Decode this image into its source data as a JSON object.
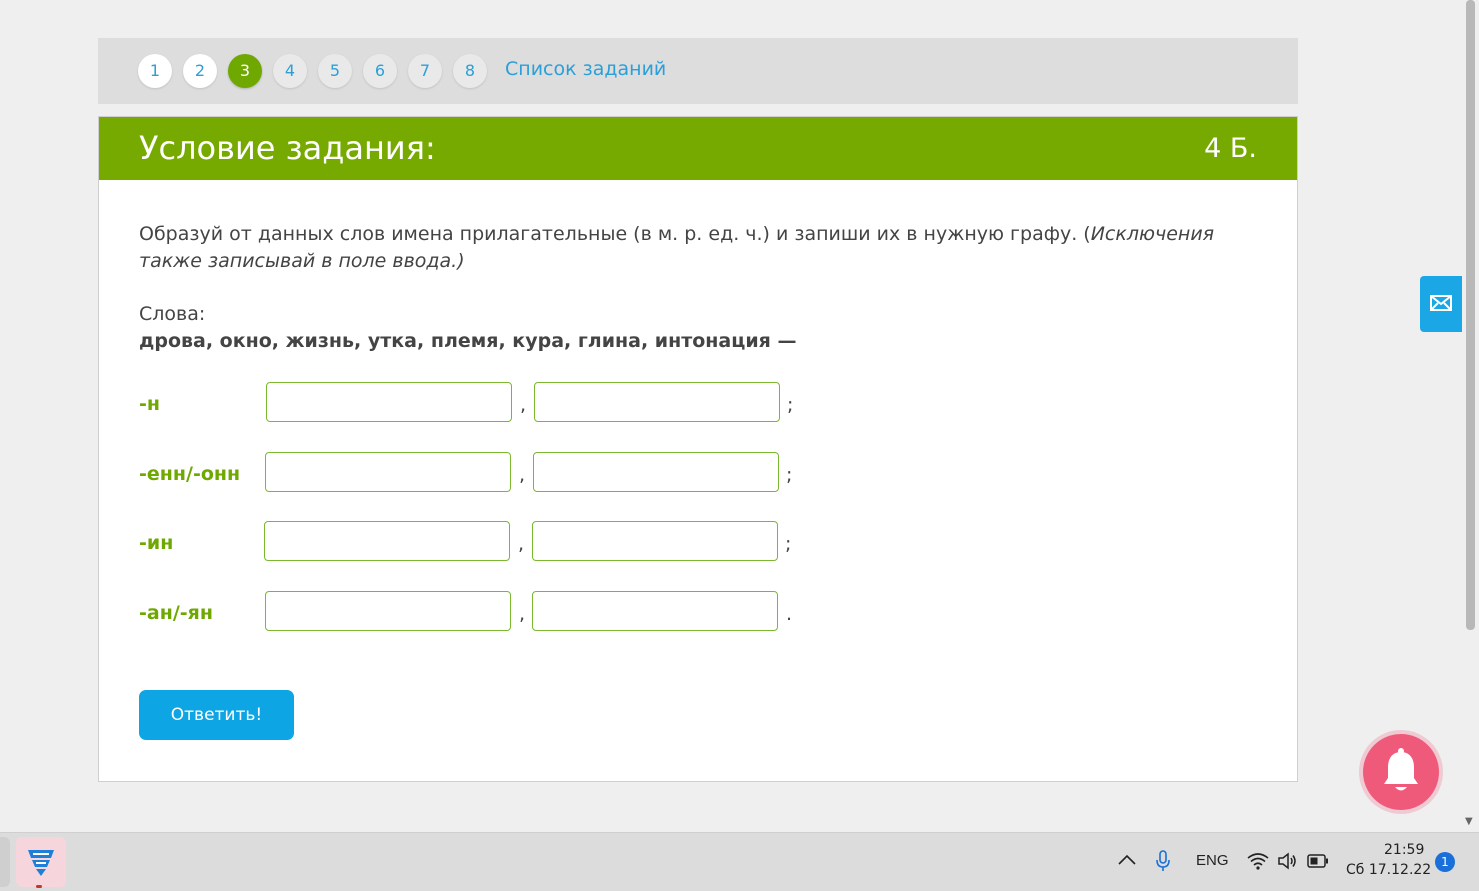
{
  "task_nav": {
    "numbers": [
      "1",
      "2",
      "3",
      "4",
      "5",
      "6",
      "7",
      "8"
    ],
    "active_index": 2,
    "list_link": "Список заданий"
  },
  "task": {
    "title": "Условие задания:",
    "points": "4 Б.",
    "instruction_main": "Образуй от данных слов имена прилагательные (в м. р. ед. ч.) и запиши их в нужную графу. (",
    "instruction_italic": "Исключения также записывай в поле ввода.)",
    "words_label": "Слова:",
    "words": "дрова, окно, жизнь, утка, племя, кура, глина, интонация —"
  },
  "answers": {
    "rows": [
      {
        "suffix": "-н",
        "value_1": "",
        "value_2": "",
        "comma": ",",
        "end": ";"
      },
      {
        "suffix": "-енн/-онн",
        "value_1": "",
        "value_2": "",
        "comma": ",",
        "end": ";"
      },
      {
        "suffix": "-ин",
        "value_1": "",
        "value_2": "",
        "comma": ",",
        "end": ";"
      },
      {
        "suffix": "-ан/-ян",
        "value_1": "",
        "value_2": "",
        "comma": ",",
        "end": "."
      }
    ]
  },
  "submit_label": "Ответить!",
  "taskbar": {
    "language": "ENG",
    "time": "21:59",
    "date": "Сб 17.12.22",
    "notification_count": "1"
  },
  "colors": {
    "accent_green": "#76aa00",
    "link_blue": "#2a9fd8",
    "button_blue": "#0ea5e4",
    "bell_pink": "#ef5a7a"
  },
  "icons": [
    "mail-icon",
    "bell-icon",
    "app-logo-icon",
    "chevron-up-icon",
    "microphone-icon",
    "wifi-icon",
    "speaker-icon",
    "battery-icon"
  ]
}
